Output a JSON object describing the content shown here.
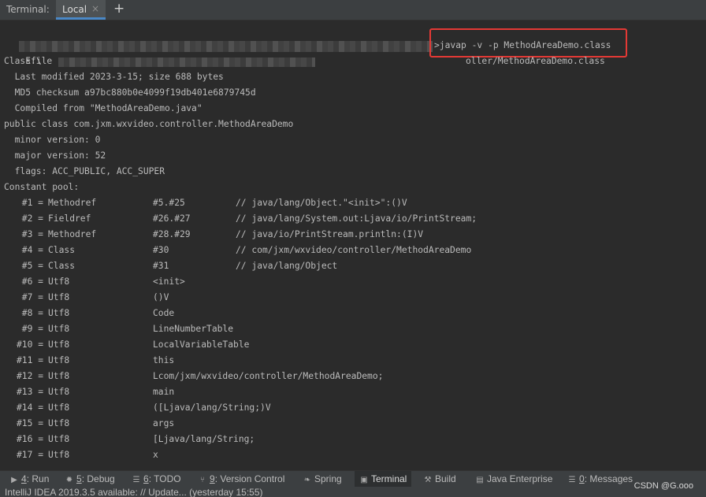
{
  "tabbar": {
    "title": "Terminal:",
    "active_tab": "Local",
    "close_glyph": "×",
    "add_glyph": "+"
  },
  "terminal": {
    "prompt_drive": "E:\\",
    "command": ">javap -v -p MethodAreaDemo.class",
    "classfile_label": "Classfile",
    "classfile_tail": "oller/MethodAreaDemo.class",
    "last_modified": "  Last modified 2023-3-15; size 688 bytes",
    "md5": "  MD5 checksum a97bc880b0e4099f19db401e6879745d",
    "compiled_from": "  Compiled from \"MethodAreaDemo.java\"",
    "class_decl": "public class com.jxm.wxvideo.controller.MethodAreaDemo",
    "minor_version": "  minor version: 0",
    "major_version": "  major version: 52",
    "flags": "  flags: ACC_PUBLIC, ACC_SUPER",
    "constant_pool_label": "Constant pool:",
    "pool": [
      {
        "num": "#1 =",
        "type": "Methodref",
        "ref": "#5.#25",
        "comment": "// java/lang/Object.\"<init>\":()V"
      },
      {
        "num": "#2 =",
        "type": "Fieldref",
        "ref": "#26.#27",
        "comment": "// java/lang/System.out:Ljava/io/PrintStream;"
      },
      {
        "num": "#3 =",
        "type": "Methodref",
        "ref": "#28.#29",
        "comment": "// java/io/PrintStream.println:(I)V"
      },
      {
        "num": "#4 =",
        "type": "Class",
        "ref": "#30",
        "comment": "// com/jxm/wxvideo/controller/MethodAreaDemo"
      },
      {
        "num": "#5 =",
        "type": "Class",
        "ref": "#31",
        "comment": "// java/lang/Object"
      },
      {
        "num": "#6 =",
        "type": "Utf8",
        "ref": "<init>",
        "comment": ""
      },
      {
        "num": "#7 =",
        "type": "Utf8",
        "ref": "()V",
        "comment": ""
      },
      {
        "num": "#8 =",
        "type": "Utf8",
        "ref": "Code",
        "comment": ""
      },
      {
        "num": "#9 =",
        "type": "Utf8",
        "ref": "LineNumberTable",
        "comment": ""
      },
      {
        "num": "#10 =",
        "type": "Utf8",
        "ref": "LocalVariableTable",
        "comment": ""
      },
      {
        "num": "#11 =",
        "type": "Utf8",
        "ref": "this",
        "comment": ""
      },
      {
        "num": "#12 =",
        "type": "Utf8",
        "ref": "Lcom/jxm/wxvideo/controller/MethodAreaDemo;",
        "comment": ""
      },
      {
        "num": "#13 =",
        "type": "Utf8",
        "ref": "main",
        "comment": ""
      },
      {
        "num": "#14 =",
        "type": "Utf8",
        "ref": "([Ljava/lang/String;)V",
        "comment": ""
      },
      {
        "num": "#15 =",
        "type": "Utf8",
        "ref": "args",
        "comment": ""
      },
      {
        "num": "#16 =",
        "type": "Utf8",
        "ref": "[Ljava/lang/String;",
        "comment": ""
      },
      {
        "num": "#17 =",
        "type": "Utf8",
        "ref": "x",
        "comment": ""
      }
    ]
  },
  "toolwindows": [
    {
      "key": "4",
      "rest": ": Run",
      "icon": "run-icon",
      "glyph": "▶",
      "active": false
    },
    {
      "key": "5",
      "rest": ": Debug",
      "icon": "debug-icon",
      "glyph": "✹",
      "active": false
    },
    {
      "key": "6",
      "rest": ": TODO",
      "icon": "todo-icon",
      "glyph": "☰",
      "active": false
    },
    {
      "key": "9",
      "rest": ": Version Control",
      "icon": "version-control-icon",
      "glyph": "⑂",
      "active": false
    },
    {
      "key": "",
      "rest": "Spring",
      "icon": "spring-leaf-icon",
      "glyph": "❧",
      "active": false
    },
    {
      "key": "",
      "rest": "Terminal",
      "icon": "terminal-icon",
      "glyph": "▣",
      "active": true
    },
    {
      "key": "",
      "rest": "Build",
      "icon": "build-hammer-icon",
      "glyph": "⚒",
      "active": false
    },
    {
      "key": "",
      "rest": "Java Enterprise",
      "icon": "java-enterprise-icon",
      "glyph": "▤",
      "active": false
    },
    {
      "key": "0",
      "rest": ": Messages",
      "icon": "messages-icon",
      "glyph": "☰",
      "active": false
    }
  ],
  "status": {
    "message": "IntelliJ IDEA 2019.3.5 available: // Update... (yesterday 15:55)"
  },
  "watermark": "CSDN @G.ooo",
  "colors": {
    "background": "#2b2b2b",
    "text": "#bbbbbb",
    "highlight_box": "#e53935",
    "active_tab_underline": "#4a88c7"
  }
}
